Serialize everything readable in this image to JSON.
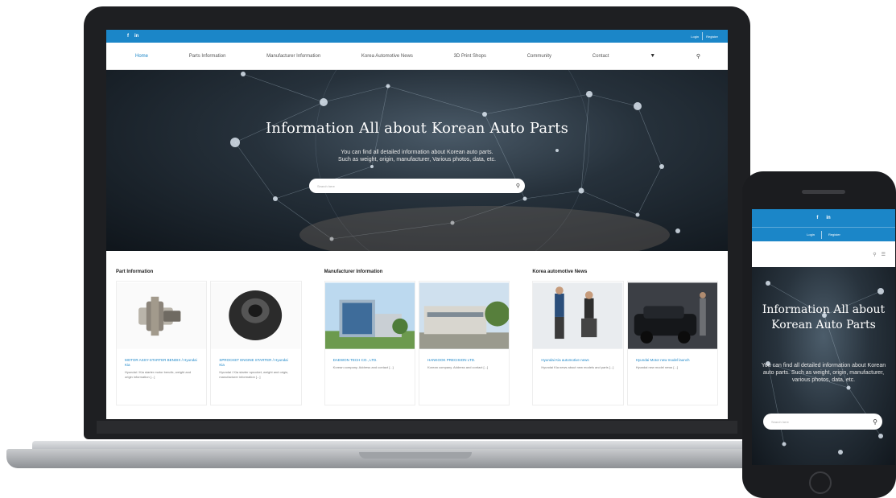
{
  "site": {
    "topbar": {
      "social": [
        "f",
        "in"
      ],
      "login": "Login",
      "register": "Register"
    },
    "nav": {
      "items": [
        "Home",
        "Parts Information",
        "Manufacturer Information",
        "Korea Automotive News",
        "3D Print Shops",
        "Community",
        "Contact"
      ],
      "more_icon": "caret-down-icon",
      "search_icon": "search-icon"
    },
    "hero": {
      "title": "Information All about Korean Auto Parts",
      "subtitle_line1": "You can find all detailed information about Korean auto parts.",
      "subtitle_line2": "Such as weight, origin, manufacturer, Various photos, data, etc.",
      "search_placeholder": "Search here"
    },
    "sections": [
      {
        "title": "Part Information",
        "cards": [
          {
            "title": "MOTOR ASSY-STARTER BENDIX / Hyundai Kia",
            "desc": "Hyundai / Kia starter motor bendix, weight and origin information [...]"
          },
          {
            "title": "SPROCKET ENGINE STARTER / Hyundai Kia",
            "desc": "Hyundai / Kia starter sprocket, weight and origin, manufacturer information [...]"
          }
        ]
      },
      {
        "title": "Manufacturer Information",
        "cards": [
          {
            "title": "DAEWON TECH CO., LTD.",
            "desc": "Korean company. Address and contact [...]"
          },
          {
            "title": "HANKOOK PRECISION LTD.",
            "desc": "Korean company. Address and contact [...]"
          }
        ]
      },
      {
        "title": "Korea automotive News",
        "cards": [
          {
            "title": "Hyundai Kia automotive news",
            "desc": "Hyundai Kia news about new models and parts [...]"
          },
          {
            "title": "Hyundai Motor new model launch",
            "desc": "Hyundai new model news [...]"
          }
        ]
      }
    ]
  },
  "mobile": {
    "social": [
      "f",
      "in"
    ],
    "login": "Login",
    "register": "Register",
    "title": "Information All about Korean Auto Parts",
    "subtitle": "You can find all detailed information about Korean auto parts. Such as weight, origin, manufacturer, various photos, data, etc.",
    "search_placeholder": "Search here"
  }
}
